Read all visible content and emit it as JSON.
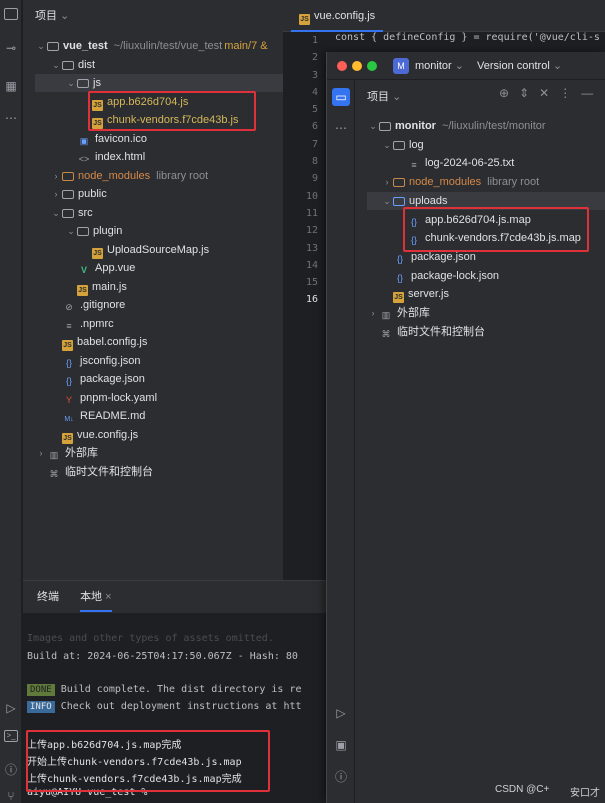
{
  "left_project": {
    "header": "项目",
    "tree": [
      {
        "label": "vue_test",
        "extra": "~/liuxulin/test/vue_test",
        "branch": "main/7 &",
        "kind": "folder",
        "depth": 0,
        "open": true
      },
      {
        "label": "dist",
        "kind": "folder",
        "depth": 1,
        "open": true
      },
      {
        "label": "js",
        "kind": "folder",
        "depth": 2,
        "open": true,
        "selected": true
      },
      {
        "label": "app.b626d704.js",
        "kind": "jsfile",
        "depth": 3
      },
      {
        "label": "chunk-vendors.f7cde43b.js",
        "kind": "jsfile",
        "depth": 3
      },
      {
        "label": "favicon.ico",
        "kind": "img",
        "depth": 2
      },
      {
        "label": "index.html",
        "kind": "html",
        "depth": 2
      },
      {
        "label": "node_modules",
        "extra": "library root",
        "kind": "folder-orange",
        "depth": 1,
        "open": false
      },
      {
        "label": "public",
        "kind": "folder",
        "depth": 1,
        "open": false
      },
      {
        "label": "src",
        "kind": "folder",
        "depth": 1,
        "open": true
      },
      {
        "label": "plugin",
        "kind": "folder",
        "depth": 2,
        "open": true
      },
      {
        "label": "UploadSourceMap.js",
        "kind": "js",
        "depth": 3
      },
      {
        "label": "App.vue",
        "kind": "vue",
        "depth": 2
      },
      {
        "label": "main.js",
        "kind": "js",
        "depth": 2
      },
      {
        "label": ".gitignore",
        "kind": "ignore",
        "depth": 1
      },
      {
        "label": ".npmrc",
        "kind": "text",
        "depth": 1
      },
      {
        "label": "babel.config.js",
        "kind": "js",
        "depth": 1
      },
      {
        "label": "jsconfig.json",
        "kind": "json",
        "depth": 1
      },
      {
        "label": "package.json",
        "kind": "json",
        "depth": 1
      },
      {
        "label": "pnpm-lock.yaml",
        "kind": "yaml",
        "depth": 1
      },
      {
        "label": "README.md",
        "kind": "md",
        "depth": 1
      },
      {
        "label": "vue.config.js",
        "kind": "js",
        "depth": 1
      },
      {
        "label": "外部库",
        "kind": "lib",
        "depth": 0
      },
      {
        "label": "临时文件和控制台",
        "kind": "scratch",
        "depth": 0
      }
    ]
  },
  "editor": {
    "tab": "vue.config.js",
    "line1": "const { defineConfig } = require('@vue/cli-s",
    "line_numbers": [
      "1",
      "2",
      "3",
      "4",
      "5",
      "6",
      "7",
      "8",
      "9",
      "10",
      "11",
      "12",
      "13",
      "14",
      "15",
      "16"
    ]
  },
  "monitor_window": {
    "project_name": "monitor",
    "vcs": "Version control",
    "header": "项目",
    "tree": [
      {
        "label": "monitor",
        "extra": "~/liuxulin/test/monitor",
        "kind": "folder",
        "depth": 0,
        "open": true
      },
      {
        "label": "log",
        "kind": "folder",
        "depth": 1,
        "open": true
      },
      {
        "label": "log-2024-06-25.txt",
        "kind": "text",
        "depth": 2
      },
      {
        "label": "node_modules",
        "extra": "library root",
        "kind": "folder-orange",
        "depth": 1,
        "open": false
      },
      {
        "label": "uploads",
        "kind": "folder-blue",
        "depth": 1,
        "open": true,
        "selected": true
      },
      {
        "label": "app.b626d704.js.map",
        "kind": "json",
        "depth": 2
      },
      {
        "label": "chunk-vendors.f7cde43b.js.map",
        "kind": "json",
        "depth": 2
      },
      {
        "label": "package.json",
        "kind": "json",
        "depth": 1
      },
      {
        "label": "package-lock.json",
        "kind": "json",
        "depth": 1
      },
      {
        "label": "server.js",
        "kind": "js",
        "depth": 1
      },
      {
        "label": "外部库",
        "kind": "lib",
        "depth": 0
      },
      {
        "label": "临时文件和控制台",
        "kind": "scratch",
        "depth": 0
      }
    ]
  },
  "terminal": {
    "tab_label": "终端",
    "tab_local": "本地",
    "line_omitted": "Images and other types of assets omitted.",
    "line_build": "Build at: 2024-06-25T04:17:50.067Z - Hash: 80",
    "done_badge": "DONE",
    "done_text": "Build complete. The dist directory is re",
    "info_badge": "INFO",
    "info_text": "Check out deployment instructions at htt",
    "upload_1": "上传app.b626d704.js.map完成",
    "upload_2": "开始上传chunk-vendors.f7cde43b.js.map",
    "upload_3": "上传chunk-vendors.f7cde43b.js.map完成",
    "prompt": "aiyu@AIYU vue_test %"
  },
  "watermark": "CSDN @C+",
  "watermark2": "安口才"
}
